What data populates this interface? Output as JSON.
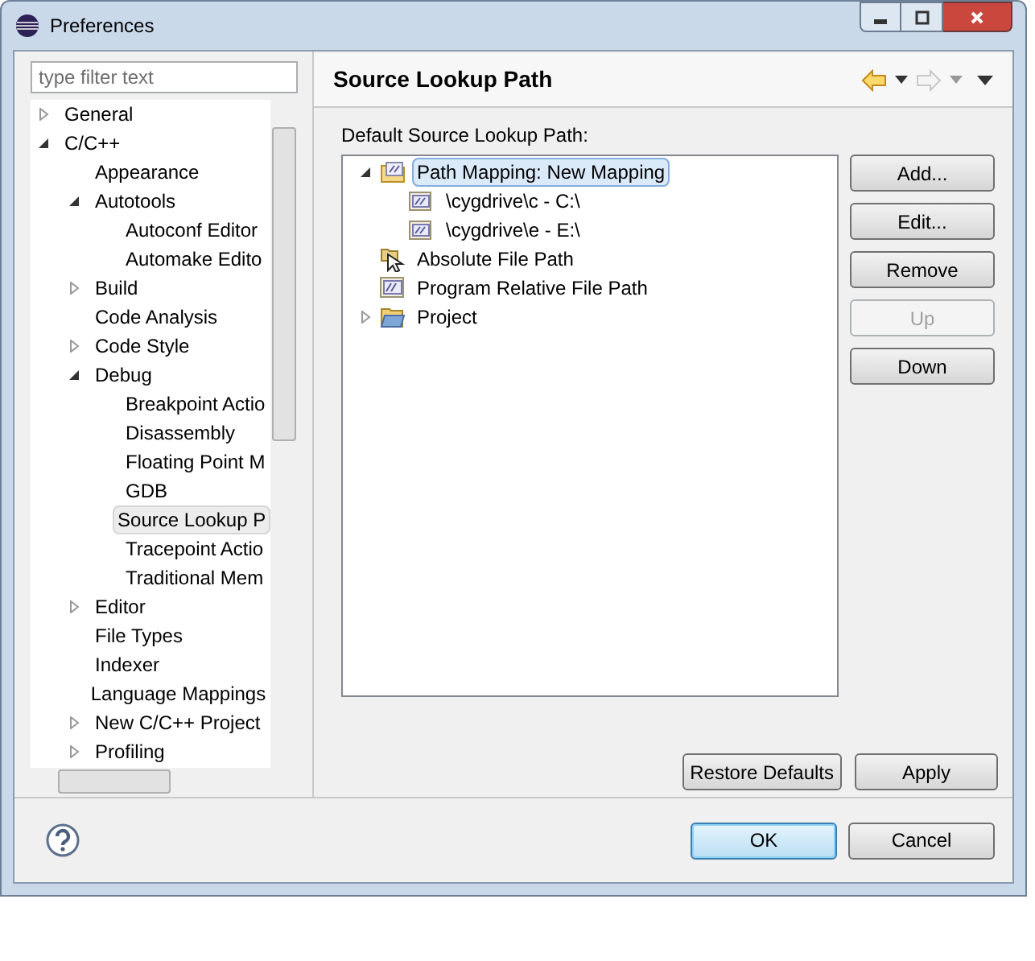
{
  "window": {
    "title": "Preferences"
  },
  "filter": {
    "placeholder": "type filter text"
  },
  "nav_tree": [
    {
      "label": "General",
      "expanded": false,
      "selected": false
    },
    {
      "label": "C/C++",
      "expanded": true,
      "selected": false,
      "children": [
        {
          "label": "Appearance",
          "selected": false
        },
        {
          "label": "Autotools",
          "expanded": true,
          "selected": false,
          "children": [
            {
              "label": "Autoconf Editor",
              "selected": false
            },
            {
              "label": "Automake Edito",
              "selected": false
            }
          ]
        },
        {
          "label": "Build",
          "expanded": false,
          "selected": false
        },
        {
          "label": "Code Analysis",
          "selected": false
        },
        {
          "label": "Code Style",
          "expanded": false,
          "selected": false
        },
        {
          "label": "Debug",
          "expanded": true,
          "selected": false,
          "children": [
            {
              "label": "Breakpoint Actio",
              "selected": false
            },
            {
              "label": "Disassembly",
              "selected": false
            },
            {
              "label": "Floating Point M",
              "selected": false
            },
            {
              "label": "GDB",
              "selected": false
            },
            {
              "label": "Source Lookup P",
              "selected": true
            },
            {
              "label": "Tracepoint Actio",
              "selected": false
            },
            {
              "label": "Traditional Mem",
              "selected": false
            }
          ]
        },
        {
          "label": "Editor",
          "expanded": false,
          "selected": false
        },
        {
          "label": "File Types",
          "selected": false
        },
        {
          "label": "Indexer",
          "selected": false
        },
        {
          "label": "Language Mappings",
          "selected": false
        },
        {
          "label": "New C/C++ Project",
          "expanded": false,
          "selected": false
        },
        {
          "label": "Profiling",
          "expanded": false,
          "selected": false
        }
      ]
    }
  ],
  "page": {
    "title": "Source Lookup Path",
    "list_label": "Default Source Lookup Path:"
  },
  "source_tree": [
    {
      "label": "Path Mapping: New Mapping",
      "kind": "mapping",
      "expanded": true,
      "selected": true,
      "children": [
        {
          "label": "\\cygdrive\\c - C:\\",
          "kind": "entry",
          "selected": false
        },
        {
          "label": "\\cygdrive\\e - E:\\",
          "kind": "entry",
          "selected": false
        }
      ]
    },
    {
      "label": "Absolute File Path",
      "kind": "absolute",
      "selected": false
    },
    {
      "label": "Program Relative File Path",
      "kind": "program",
      "selected": false
    },
    {
      "label": "Project",
      "kind": "project",
      "expanded": false,
      "selected": false
    }
  ],
  "side_buttons": [
    {
      "label": "Add...",
      "disabled": false
    },
    {
      "label": "Edit...",
      "disabled": false
    },
    {
      "label": "Remove",
      "disabled": false
    },
    {
      "label": "Up",
      "disabled": true
    },
    {
      "label": "Down",
      "disabled": false
    }
  ],
  "page_buttons": [
    "Restore Defaults",
    "Apply"
  ],
  "dialog_buttons": [
    {
      "label": "OK",
      "default": true
    },
    {
      "label": "Cancel",
      "default": false
    }
  ]
}
